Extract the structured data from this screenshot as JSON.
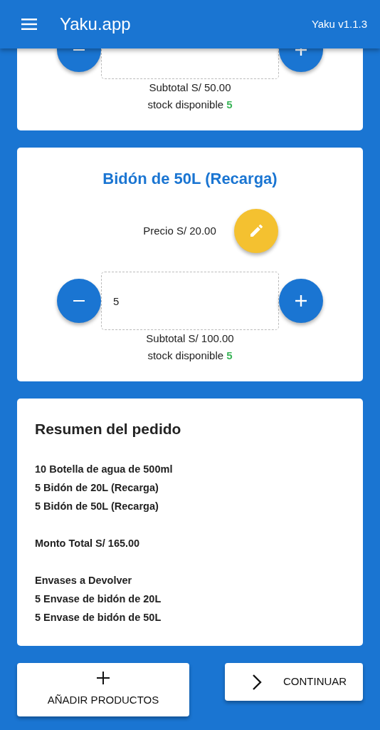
{
  "app_bar": {
    "title": "Yaku.app",
    "version": "Yaku v1.1.3"
  },
  "products": [
    {
      "subtotal": "Subtotal S/ 50.00",
      "stock": "stock disponible **5**"
    },
    {
      "name": "Bidón de 50L (Recarga)",
      "price": "Precio S/ 20.00",
      "quantity": "5",
      "subtotal": "Subtotal S/ 100.00",
      "stock": "stock disponible **5**"
    }
  ],
  "summary": {
    "title": "Resumen del pedido",
    "items": [
      "10 Botella de agua de 500ml",
      "5 Bidón de 20L (Recarga)",
      "5 Bidón de 50L (Recarga)"
    ],
    "total": "Monto Total S/ 165.00",
    "returns_title": "Envases a Devolver",
    "returns": [
      "5 Envase de bidón de 20L",
      "5 Envase de bidón de 50L"
    ]
  },
  "buttons": [
    {
      "kind": "add",
      "label": "AÑADIR PRODUCTOS"
    },
    {
      "kind": "continue",
      "label": "CONTINUAR"
    }
  ]
}
